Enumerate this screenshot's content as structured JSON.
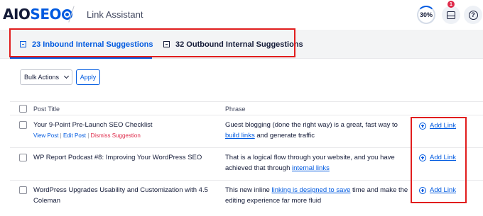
{
  "header": {
    "logo_part1": "AIO",
    "logo_part2": "SEO",
    "page_title": "Link Assistant",
    "score": "30%",
    "notification_count": "1"
  },
  "icons": {
    "logo_gear": "gear-icon",
    "notifications": "inbox-icon",
    "help": "help-icon",
    "tab": "link-box-icon",
    "add": "plus-circle-icon",
    "chevron": "chevron-down-icon"
  },
  "tabs": [
    {
      "label": "23 Inbound Internal Suggestions",
      "active": true
    },
    {
      "label": "32 Outbound Internal Suggestions",
      "active": false
    }
  ],
  "toolbar": {
    "bulk_actions": "Bulk Actions",
    "apply": "Apply"
  },
  "table": {
    "col_post_title": "Post Title",
    "col_phrase": "Phrase",
    "rows": [
      {
        "title": "Your 9-Point Pre-Launch SEO Checklist",
        "action_view": "View Post",
        "sep1": " | ",
        "action_edit": "Edit Post",
        "sep2": " | ",
        "action_dismiss": "Dismiss Suggestion",
        "phrase_before": "Guest blogging (done the right way) is a great, fast way to ",
        "phrase_link": "build links",
        "phrase_after": " and generate traffic",
        "add_link": "Add Link"
      },
      {
        "title": "WP Report Podcast #8: Improving Your WordPress SEO",
        "phrase_before": "That is a logical flow through your website, and you have achieved that through ",
        "phrase_link": "internal links",
        "phrase_after": "",
        "add_link": "Add Link"
      },
      {
        "title": "WordPress Upgrades Usability and Customization with 4.5 Coleman",
        "phrase_before": "This new inline ",
        "phrase_link": "linking is designed to save",
        "phrase_after": " time and make the editing experience far more fluid",
        "add_link": "Add Link"
      }
    ]
  },
  "colors": {
    "accent": "#005ae0",
    "highlight_box": "#e11d1d",
    "danger": "#df2a4a",
    "text": "#141b38"
  }
}
